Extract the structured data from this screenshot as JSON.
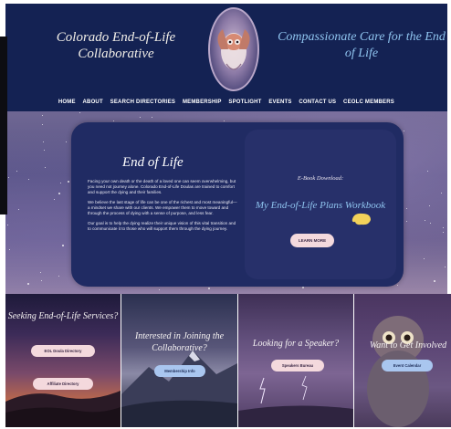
{
  "header": {
    "brand_left": "Colorado End-of-Life Collaborative",
    "brand_right": "Compassionate Care for the End of Life",
    "logo_icon": "owl-seal-logo"
  },
  "nav": [
    "HOME",
    "ABOUT",
    "SEARCH DIRECTORIES",
    "MEMBERSHIP",
    "SPOTLIGHT",
    "EVENTS",
    "CONTACT US",
    "CEOLC MEMBERS"
  ],
  "hero": {
    "title": "End of Life",
    "paragraphs": [
      "Facing your own death or the death of a loved one can seem overwhelming, but you need not journey alone. Colorado End-of-Life Doulas are trained to comfort and support the dying and their families.",
      "We believe the last stage of life can be one of the richest and most meaningful—a mindset we share with our clients. We empower them to move toward and through the process of dying with a sense of purpose, and less fear.",
      "Our goal is to help the dying realize their unique vision of this vital transition and to communicate it to those who will support them through the dying journey."
    ],
    "ebook_label": "E-Book Download:",
    "ebook_title": "My End-of-Life Plans Workbook",
    "ebook_button": "LEARN MORE"
  },
  "cards": [
    {
      "title": "Seeking End-of-Life Services?",
      "buttons": [
        "EOL Doula Directory",
        "Affiliate Directory"
      ]
    },
    {
      "title": "Interested in Joining the Collaborative?",
      "buttons": [
        "Membership Info"
      ]
    },
    {
      "title": "Looking for a Speaker?",
      "buttons": [
        "Speakers Bureau"
      ]
    },
    {
      "title": "Want to Get Involved",
      "buttons": [
        "Event Calendar"
      ]
    }
  ],
  "colors": {
    "header_bg": "#142253",
    "accent_blue": "#8fc4ef",
    "pill_pink": "#f4d9dd",
    "pill_blue": "#a9c6ef"
  }
}
